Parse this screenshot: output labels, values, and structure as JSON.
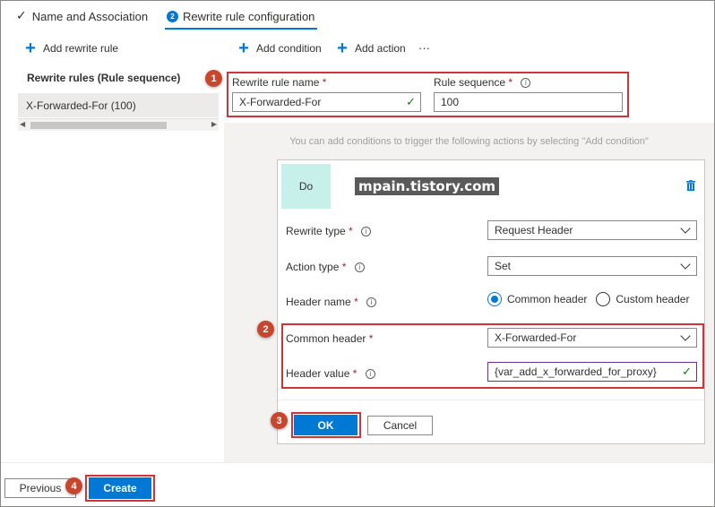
{
  "tabs": [
    {
      "label": "Name and Association",
      "state": "completed"
    },
    {
      "label": "Rewrite rule configuration",
      "step": "2",
      "state": "active"
    }
  ],
  "left": {
    "add_label": "Add rewrite rule",
    "list_header": "Rewrite rules (Rule sequence)",
    "rows": [
      "X-Forwarded-For (100)"
    ]
  },
  "toolbar": {
    "add_condition": "Add condition",
    "add_action": "Add action",
    "more": "···"
  },
  "rule": {
    "name_label": "Rewrite rule name",
    "name_value": "X-Forwarded-For",
    "sequence_label": "Rule sequence",
    "sequence_value": "100"
  },
  "required_mark": "*",
  "info_glyph": "i",
  "hint": "You can add conditions to trigger the following actions by selecting \"Add condition\"",
  "action": {
    "do_label": "Do",
    "rewrite_type_label": "Rewrite type",
    "rewrite_type_value": "Request Header",
    "action_type_label": "Action type",
    "action_type_value": "Set",
    "header_name_label": "Header name",
    "header_name_options": [
      "Common header",
      "Custom header"
    ],
    "header_name_selected": "Common header",
    "common_header_label": "Common header",
    "common_header_value": "X-Forwarded-For",
    "header_value_label": "Header value",
    "header_value_value": "{var_add_x_forwarded_for_proxy}"
  },
  "buttons": {
    "ok": "OK",
    "cancel": "Cancel",
    "previous": "Previous",
    "create": "Create"
  },
  "watermark": "mpain.tistory.com",
  "markers": [
    "1",
    "2",
    "3",
    "4"
  ],
  "colors": {
    "accent": "#0078d4",
    "highlight": "#d13438",
    "marker": "#c8462d",
    "do_bg": "#c7f0ea"
  }
}
